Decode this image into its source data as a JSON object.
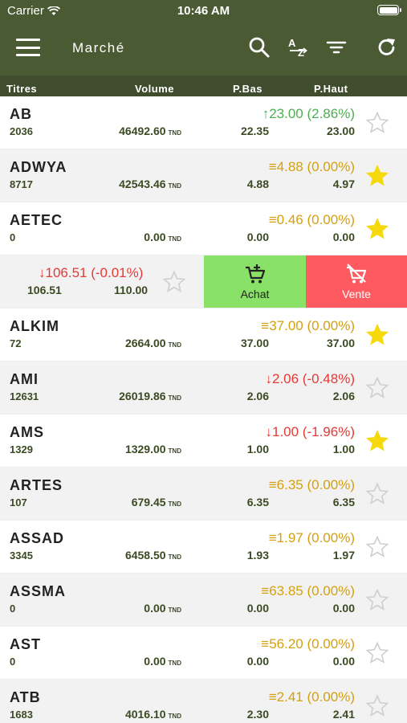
{
  "status_bar": {
    "carrier": "Carrier",
    "time": "10:46 AM"
  },
  "nav": {
    "title": "Marché"
  },
  "columns": {
    "titres": "Titres",
    "volume": "Volume",
    "pbas": "P.Bas",
    "phaut": "P.Haut"
  },
  "unit": "TND",
  "rows": [
    {
      "name": "AB",
      "qty": "2036",
      "volume": "46492.60",
      "change": "23.00 (2.86%)",
      "trend": "up",
      "pbas": "22.35",
      "phaut": "23.00",
      "favorite": false
    },
    {
      "name": "ADWYA",
      "qty": "8717",
      "volume": "42543.46",
      "change": "4.88 (0.00%)",
      "trend": "flat",
      "pbas": "4.88",
      "phaut": "4.97",
      "favorite": true
    },
    {
      "name": "AETEC",
      "qty": "0",
      "volume": "0.00",
      "change": "0.46 (0.00%)",
      "trend": "flat",
      "pbas": "0.00",
      "phaut": "0.00",
      "favorite": true
    },
    {
      "name": "",
      "qty": "",
      "volume": "",
      "change": "106.51 (-0.01%)",
      "trend": "down",
      "pbas": "106.51",
      "phaut": "110.00",
      "favorite": false,
      "swiped": true
    },
    {
      "name": "ALKIM",
      "qty": "72",
      "volume": "2664.00",
      "change": "37.00 (0.00%)",
      "trend": "flat",
      "pbas": "37.00",
      "phaut": "37.00",
      "favorite": true
    },
    {
      "name": "AMI",
      "qty": "12631",
      "volume": "26019.86",
      "change": "2.06 (-0.48%)",
      "trend": "down",
      "pbas": "2.06",
      "phaut": "2.06",
      "favorite": false
    },
    {
      "name": "AMS",
      "qty": "1329",
      "volume": "1329.00",
      "change": "1.00 (-1.96%)",
      "trend": "down",
      "pbas": "1.00",
      "phaut": "1.00",
      "favorite": true
    },
    {
      "name": "ARTES",
      "qty": "107",
      "volume": "679.45",
      "change": "6.35 (0.00%)",
      "trend": "flat",
      "pbas": "6.35",
      "phaut": "6.35",
      "favorite": false
    },
    {
      "name": "ASSAD",
      "qty": "3345",
      "volume": "6458.50",
      "change": "1.97 (0.00%)",
      "trend": "flat",
      "pbas": "1.93",
      "phaut": "1.97",
      "favorite": false
    },
    {
      "name": "ASSMA",
      "qty": "0",
      "volume": "0.00",
      "change": "63.85 (0.00%)",
      "trend": "flat",
      "pbas": "0.00",
      "phaut": "0.00",
      "favorite": false
    },
    {
      "name": "AST",
      "qty": "0",
      "volume": "0.00",
      "change": "56.20 (0.00%)",
      "trend": "flat",
      "pbas": "0.00",
      "phaut": "0.00",
      "favorite": false
    },
    {
      "name": "ATB",
      "qty": "1683",
      "volume": "4016.10",
      "change": "2.41 (0.00%)",
      "trend": "flat",
      "pbas": "2.30",
      "phaut": "2.41",
      "favorite": false
    }
  ],
  "swipe_actions": {
    "achat": "Achat",
    "vente": "Vente"
  },
  "colors": {
    "nav": "#4a5b34",
    "up": "#4caf50",
    "flat": "#d4a010",
    "down": "#e53935",
    "achat": "#89e267",
    "vente": "#ff5a5f",
    "star_on": "#f5d90a"
  }
}
